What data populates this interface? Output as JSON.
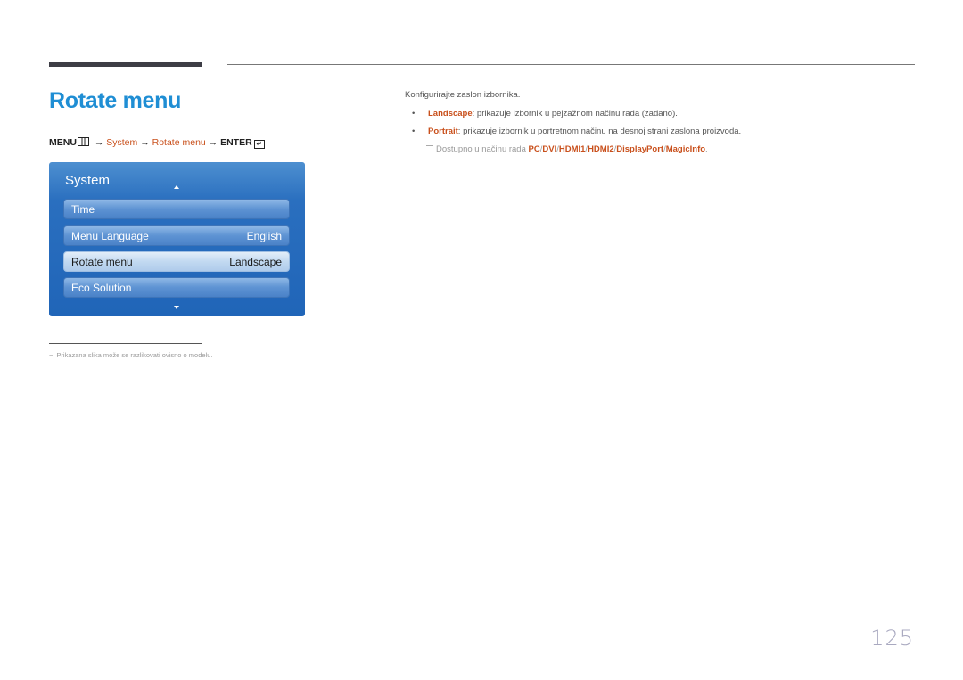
{
  "title": "Rotate menu",
  "nav_path": {
    "menu": "MENU",
    "arrow": "→",
    "system": "System",
    "rotate": "Rotate menu",
    "enter": "ENTER",
    "enter_glyph": "↵"
  },
  "osd": {
    "title": "System",
    "items": [
      {
        "label": "Time",
        "value": "",
        "selected": false
      },
      {
        "label": "Menu Language",
        "value": "English",
        "selected": false
      },
      {
        "label": "Rotate menu",
        "value": "Landscape",
        "selected": true
      },
      {
        "label": "Eco Solution",
        "value": "",
        "selected": false
      }
    ]
  },
  "footnote": {
    "dash": "−",
    "text": "Prikazana slika može se razlikovati ovisno o modelu."
  },
  "description": {
    "intro": "Konfigurirajte zaslon izbornika.",
    "bullets": [
      {
        "dot": "•",
        "keyword": "Landscape",
        "text": ": prikazuje izbornik u pejzažnom načinu rada (zadano)."
      },
      {
        "dot": "•",
        "keyword": "Portrait",
        "text": ": prikazuje izbornik u portretnom načinu na desnoj strani zaslona proizvoda."
      }
    ],
    "note": {
      "prefix": "Dostupno u načinu rada ",
      "modes": [
        "PC",
        "DVI",
        "HDMI1",
        "HDMI2",
        "DisplayPort",
        "MagicInfo"
      ],
      "separator": "/",
      "suffix": "."
    }
  },
  "page_number": "125"
}
